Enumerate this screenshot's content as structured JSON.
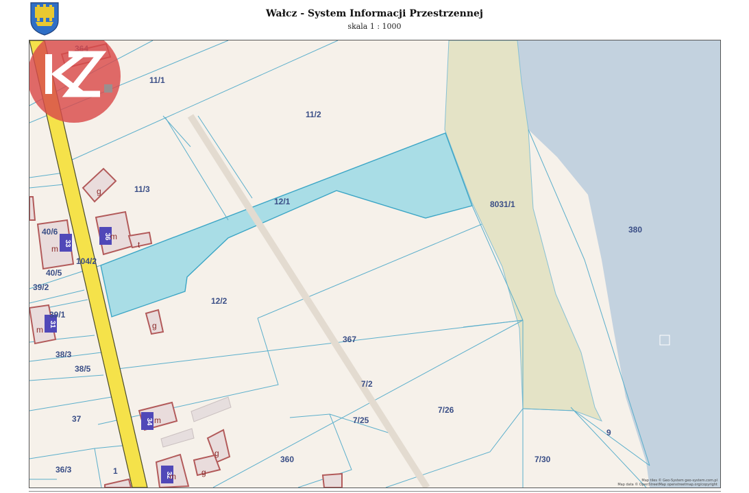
{
  "header": {
    "title": "Wałcz - System Informacji Przestrzennej",
    "scale": "skala 1 : 1000"
  },
  "logo": {
    "text": "KZ"
  },
  "map": {
    "colors": {
      "land": "#f6f1ea",
      "water": "#c3d2df",
      "green": "#e4e3c6",
      "highlight": "#a9dde6",
      "road": "#f5e24a",
      "parcel_line": "#5aaecb",
      "building_fill": "#e9dcdc",
      "building_stroke": "#b25a5a",
      "address_box": "#5048b8"
    },
    "parcels": [
      "364",
      "11/1",
      "11/2",
      "11/3",
      "12/1",
      "8031/1",
      "380",
      "40/6",
      "104/2",
      "40/5",
      "39/2",
      "39/1",
      "12/2",
      "38/3",
      "367",
      "38/5",
      "7/2",
      "37",
      "7/25",
      "7/26",
      "9",
      "360",
      "7/30",
      "36/3",
      "1"
    ],
    "building_labels": [
      "g",
      "m",
      "t",
      "m",
      "m",
      "g",
      "m",
      "g",
      "g",
      "m"
    ],
    "address_numbers": [
      "33",
      "36",
      "31",
      "34",
      "32"
    ],
    "attribution": [
      "Map tiles © Geo-System geo-system.com.pl",
      "Map data © OpenStreetMap openstreetmap.org/copyright"
    ]
  }
}
